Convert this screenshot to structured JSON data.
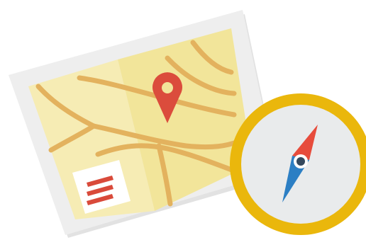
{
  "illustration": {
    "name": "map-and-compass",
    "map": {
      "paper_color": "#eeeeee",
      "paper_shadow_color": "#e2e2e2",
      "left_panel_color": "#f6ecb4",
      "right_panel_color": "#f2e59a",
      "road_color": "#e3b25e",
      "pin_color": "#db4c3c",
      "legend_box_color": "#ffffff",
      "legend_lines_color": "#d94a3a",
      "legend_line_count": 3
    },
    "compass": {
      "rim_color": "#eab70c",
      "face_color": "#e9ebec",
      "north_needle_color": "#e74c3c",
      "south_needle_color": "#2c7fc4",
      "pivot_outer_color": "#ffffff",
      "pivot_inner_color": "#34495e"
    }
  }
}
